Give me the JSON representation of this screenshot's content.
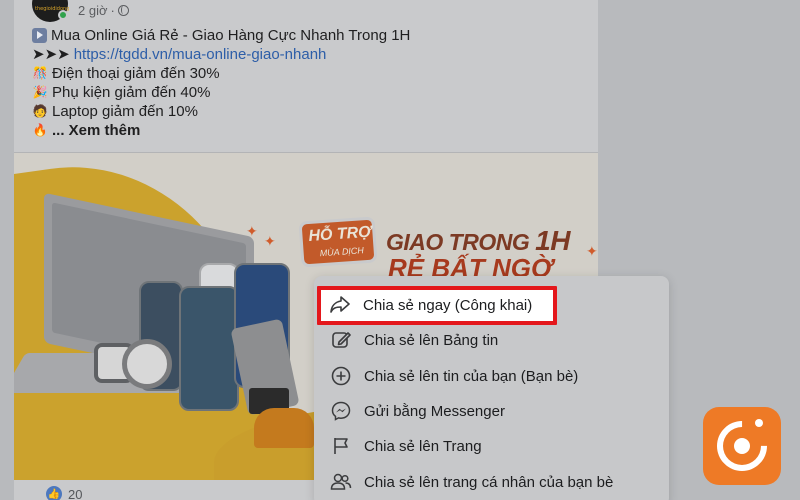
{
  "post": {
    "time": "2 giờ",
    "lines": [
      {
        "icon": "play-icon",
        "text": "Mua Online Giá Rẻ - Giao Hàng Cực Nhanh Trong 1H"
      },
      {
        "icon": "arrows-icon",
        "prefix": "➤➤➤",
        "link": "https://tgdd.vn/mua-online-giao-nhanh"
      },
      {
        "icon": "confetti-icon",
        "text": "Điện thoại giảm đến 30%"
      },
      {
        "icon": "party-popper-icon",
        "text": "Phụ kiện giảm đến 40%"
      },
      {
        "icon": "person-laptop-icon",
        "text": "Laptop giảm đến 10%"
      },
      {
        "icon": "fire-icon",
        "text": "... Xem thêm"
      }
    ],
    "avatar_text": "thegioididong",
    "reaction_count": "20"
  },
  "banner": {
    "promo_main": "HỖ TRỢ",
    "promo_sub": "MÙA DỊCH",
    "title_prefix": "GIAO TRONG ",
    "title_big": "1H",
    "subtitle": "RẺ BẤT NGỜ"
  },
  "share_menu": {
    "items": [
      {
        "icon": "share-arrow-icon",
        "label": "Chia sẻ ngay (Công khai)"
      },
      {
        "icon": "edit-icon",
        "label": "Chia sẻ lên Bảng tin"
      },
      {
        "icon": "plus-circle-icon",
        "label": "Chia sẻ lên tin của bạn (Bạn bè)"
      },
      {
        "icon": "messenger-icon",
        "label": "Gửi bằng Messenger"
      },
      {
        "icon": "flag-icon",
        "label": "Chia sẻ lên Trang"
      },
      {
        "icon": "friends-icon",
        "label": "Chia sẻ lên trang cá nhân của bạn bè"
      }
    ]
  },
  "colors": {
    "highlight_border": "#e4171c",
    "badge": "#ee7a26",
    "link": "#2d5ea8"
  }
}
